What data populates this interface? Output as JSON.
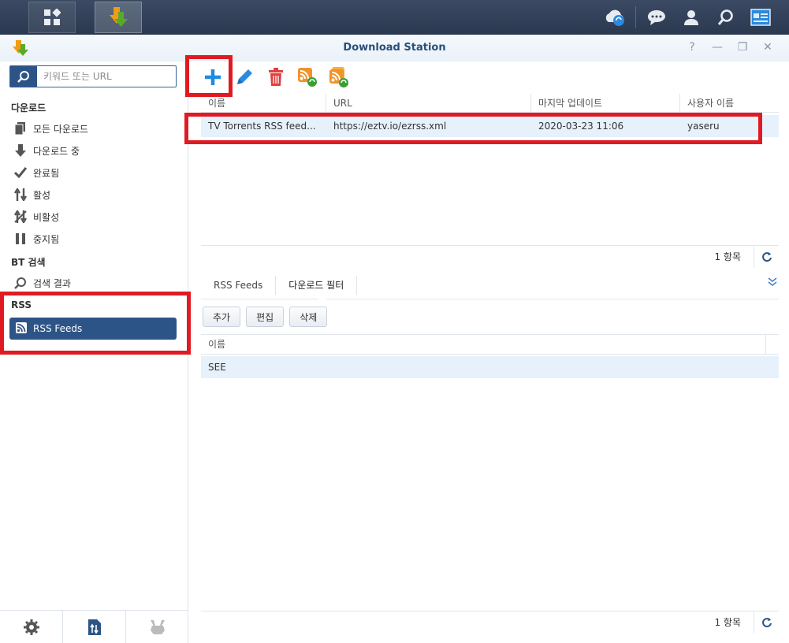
{
  "window": {
    "title": "Download Station"
  },
  "search": {
    "placeholder": "키워드 또는 URL"
  },
  "sidebar": {
    "download_section": "다운로드",
    "items": [
      {
        "label": "모든 다운로드"
      },
      {
        "label": "다운로드 중"
      },
      {
        "label": "완료됨"
      },
      {
        "label": "활성"
      },
      {
        "label": "비활성"
      },
      {
        "label": "중지됨"
      }
    ],
    "bt_section": "BT 검색",
    "bt_item": "검색 결과",
    "rss_section": "RSS",
    "rss_item": "RSS Feeds"
  },
  "feeds_table": {
    "columns": [
      "이름",
      "URL",
      "마지막 업데이트",
      "사용자 이름"
    ],
    "rows": [
      {
        "name": "TV Torrents RSS feed...",
        "url": "https://eztv.io/ezrss.xml",
        "updated": "2020-03-23 11:06",
        "user": "yaseru"
      }
    ],
    "count": "1 항목"
  },
  "lower": {
    "tabs": [
      "RSS Feeds",
      "다운로드 필터"
    ],
    "buttons": {
      "add": "추가",
      "edit": "편집",
      "delete": "삭제"
    },
    "filter_column": "이름",
    "filters": [
      {
        "name": "SEE"
      }
    ],
    "count": "1 항목"
  },
  "colors": {
    "accent": "#2d5487",
    "highlight": "#e01a22",
    "selected_row": "#e7f1fb"
  }
}
